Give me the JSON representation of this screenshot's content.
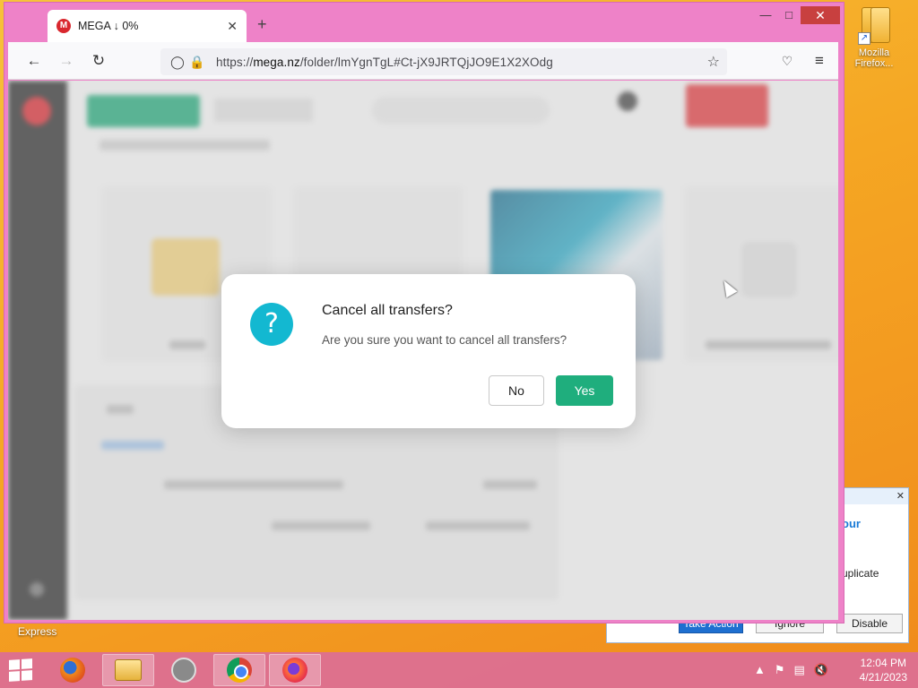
{
  "desktop": {
    "icon_label": "Mozilla Firefox...",
    "express_label": "Express"
  },
  "notification": {
    "heading_fragment": "our",
    "body_fragment": "uplicate",
    "take_action": "Take Action",
    "ignore": "Ignore",
    "disable": "Disable"
  },
  "browser": {
    "tab_title": "MEGA ↓ 0%",
    "url_prefix": "https://",
    "url_domain": "mega.nz",
    "url_path": "/folder/lmYgnTgL#Ct-jX9JRTQjJO9E1X2XOdg"
  },
  "dialog": {
    "title": "Cancel all transfers?",
    "message": "Are you sure you want to cancel all transfers?",
    "no_label": "No",
    "yes_label": "Yes"
  },
  "taskbar": {
    "time": "12:04 PM",
    "date": "4/21/2023"
  },
  "colors": {
    "window_frame": "#ee82c8",
    "mega_red": "#d9272e",
    "dialog_icon": "#13b8d1",
    "yes_button": "#1fae7d"
  }
}
